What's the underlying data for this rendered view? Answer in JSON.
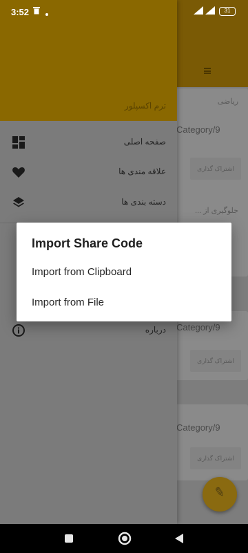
{
  "status_bar": {
    "time": "3:52",
    "battery": "31",
    "icons": [
      "trash-icon",
      "dot-icon",
      "signal-icon",
      "wifi-icon",
      "battery-icon"
    ]
  },
  "drawer": {
    "header_title": "ترم اکسپلور",
    "items": [
      {
        "label": "صفحه اصلی",
        "icon": "dashboard-icon"
      },
      {
        "label": "علاقه مندی ها",
        "icon": "heart-icon"
      },
      {
        "label": "دسته بندی ها",
        "icon": "layers-icon"
      },
      {
        "label": "درباره",
        "icon": "info-icon"
      }
    ]
  },
  "background_app": {
    "cards": [
      {
        "title": "ریاضی",
        "category": "Category/9",
        "button": "اشتراک گذاری"
      },
      {
        "title": "جلوگیری از ...",
        "category": "",
        "button": ""
      },
      {
        "title": "",
        "category": "Category/9",
        "button": "اشتراک گذاری"
      },
      {
        "title": "",
        "category": "Category/9",
        "button": "اشتراک گذاری"
      }
    ],
    "fab_icon": "pencil-icon"
  },
  "dialog": {
    "title": "Import Share Code",
    "options": [
      {
        "label": "Import from Clipboard"
      },
      {
        "label": "Import from File"
      }
    ]
  },
  "nav_bar": {
    "buttons": [
      "recents-icon",
      "home-icon",
      "back-icon"
    ]
  }
}
